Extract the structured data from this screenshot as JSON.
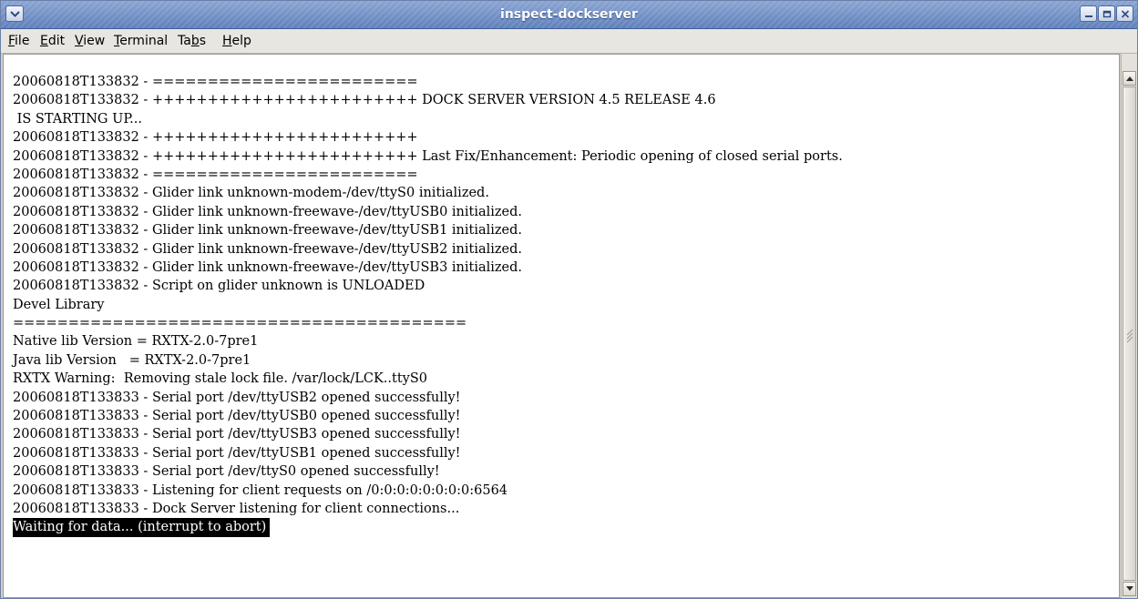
{
  "window": {
    "title": "inspect-dockserver"
  },
  "menu": [
    {
      "pre": "",
      "acc": "F",
      "post": "ile"
    },
    {
      "pre": "",
      "acc": "E",
      "post": "dit"
    },
    {
      "pre": "",
      "acc": "V",
      "post": "iew"
    },
    {
      "pre": "",
      "acc": "T",
      "post": "erminal"
    },
    {
      "pre": "Ta",
      "acc": "b",
      "post": "s"
    },
    {
      "pre": "",
      "acc": "H",
      "post": "elp"
    }
  ],
  "terminal": {
    "lines": [
      "20060818T133832 - ========================",
      "20060818T133832 - ++++++++++++++++++++++++ DOCK SERVER VERSION 4.5 RELEASE 4.6",
      " IS STARTING UP...",
      "20060818T133832 - ++++++++++++++++++++++++",
      "20060818T133832 - ++++++++++++++++++++++++ Last Fix/Enhancement: Periodic opening of closed serial ports.",
      "20060818T133832 - ========================",
      "20060818T133832 - Glider link unknown-modem-/dev/ttyS0 initialized.",
      "20060818T133832 - Glider link unknown-freewave-/dev/ttyUSB0 initialized.",
      "20060818T133832 - Glider link unknown-freewave-/dev/ttyUSB1 initialized.",
      "20060818T133832 - Glider link unknown-freewave-/dev/ttyUSB2 initialized.",
      "20060818T133832 - Glider link unknown-freewave-/dev/ttyUSB3 initialized.",
      "20060818T133832 - Script on glider unknown is UNLOADED",
      "Devel Library",
      "=========================================",
      "Native lib Version = RXTX-2.0-7pre1",
      "Java lib Version   = RXTX-2.0-7pre1",
      "RXTX Warning:  Removing stale lock file. /var/lock/LCK..ttyS0",
      "20060818T133833 - Serial port /dev/ttyUSB2 opened successfully!",
      "20060818T133833 - Serial port /dev/ttyUSB0 opened successfully!",
      "20060818T133833 - Serial port /dev/ttyUSB3 opened successfully!",
      "20060818T133833 - Serial port /dev/ttyUSB1 opened successfully!",
      "20060818T133833 - Serial port /dev/ttyS0 opened successfully!",
      "20060818T133833 - Listening for client requests on /0:0:0:0:0:0:0:0:6564",
      "20060818T133833 - Dock Server listening for client connections..."
    ],
    "prompt_line": "Waiting for data... (interrupt to abort)"
  },
  "icons": {
    "window_menu": "chevron-down-icon",
    "minimize": "minimize-icon",
    "maximize": "maximize-icon",
    "close": "close-icon",
    "scroll_up": "arrow-up-icon",
    "scroll_down": "arrow-down-icon"
  },
  "colors": {
    "titlebar": "#6f8dc4",
    "terminal_bg": "#ffffff",
    "terminal_fg": "#000000",
    "highlight_bg": "#000000",
    "highlight_fg": "#ffffff"
  }
}
